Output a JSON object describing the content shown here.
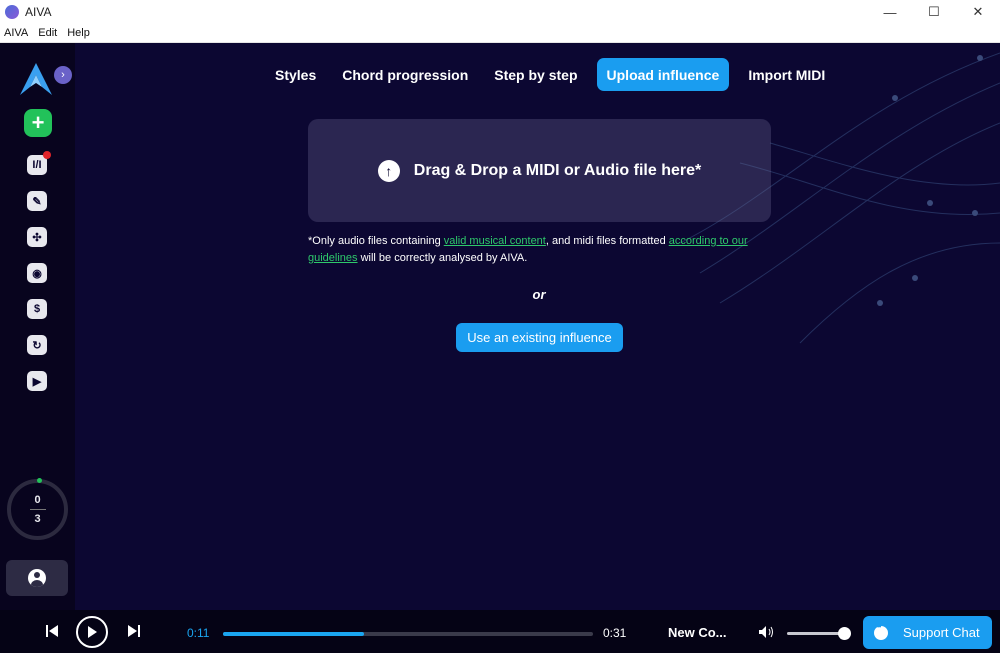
{
  "window": {
    "title": "AIVA",
    "controls": {
      "minimize": "—",
      "maximize": "☐",
      "close": "✕"
    }
  },
  "menu": [
    "AIVA",
    "Edit",
    "Help"
  ],
  "sidebar": {
    "expand_glyph": "›",
    "new_glyph": "+",
    "icons": [
      "library-icon",
      "pencil-icon",
      "fan-icon",
      "broadcast-icon",
      "dollar-icon",
      "history-icon",
      "play-icon"
    ],
    "counter": {
      "top": "0",
      "bottom": "3"
    }
  },
  "tabs": [
    {
      "label": "Styles",
      "active": false
    },
    {
      "label": "Chord progression",
      "active": false
    },
    {
      "label": "Step by step",
      "active": false
    },
    {
      "label": "Upload influence",
      "active": true
    },
    {
      "label": "Import MIDI",
      "active": false
    }
  ],
  "dropzone": {
    "label": "Drag & Drop a MIDI or Audio file here*"
  },
  "note": {
    "part1": "*Only audio files containing ",
    "link1": "valid musical content",
    "part2": ", and midi files formatted ",
    "link2": "according to our guidelines",
    "part3": " will be correctly analysed by AIVA."
  },
  "or_text": "or",
  "existing_button": "Use an existing influence",
  "player": {
    "current_time": "0:11",
    "duration": "0:31",
    "progress_fraction": 0.38,
    "track_name": "New Co...",
    "volume_fraction": 0.9,
    "support_label": "Support Chat"
  },
  "colors": {
    "accent": "#1a9df0",
    "green": "#22c25a",
    "background": "#0c0732"
  }
}
